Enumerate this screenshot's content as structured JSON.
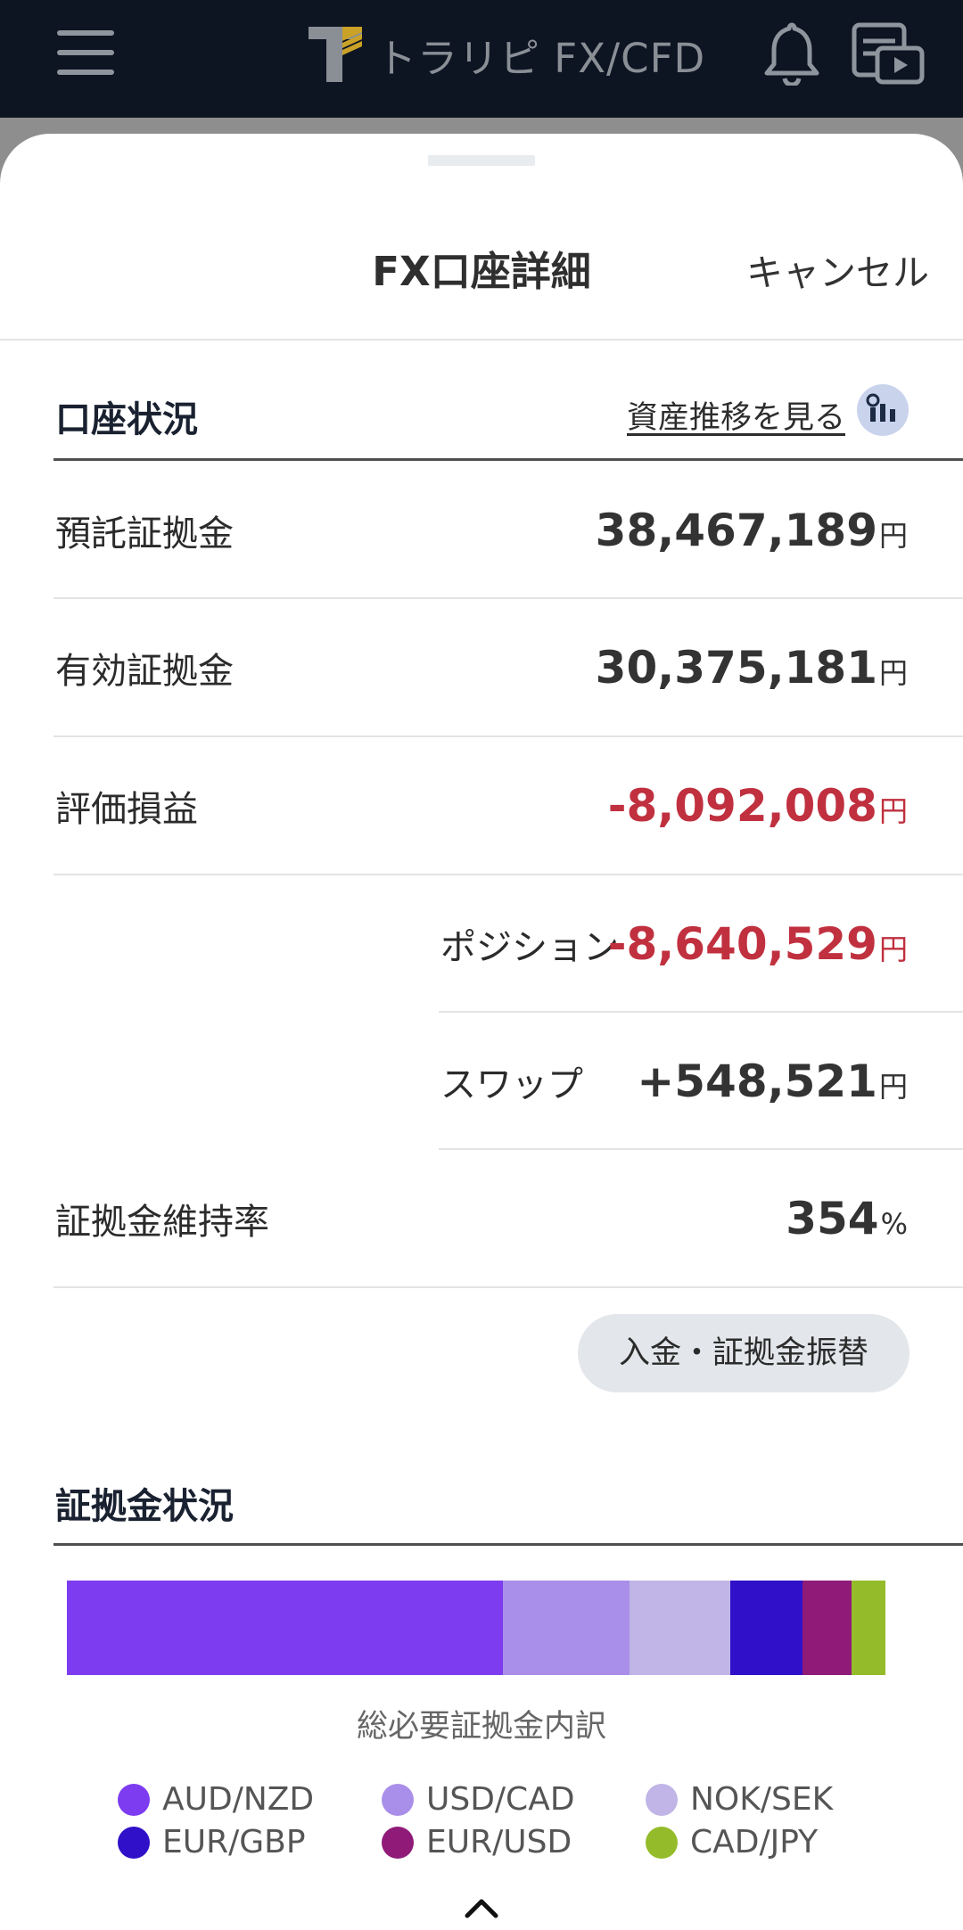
{
  "appbar": {
    "logo_text": "トラリピ FX/CFD"
  },
  "sheet": {
    "title": "FX口座詳細",
    "cancel_label": "キャンセル"
  },
  "account": {
    "section_title": "口座状況",
    "history_link": "資産推移を見る",
    "rows": [
      {
        "label": "預託証拠金",
        "value": "38,467,189",
        "unit": "円"
      },
      {
        "label": "有効証拠金",
        "value": "30,375,181",
        "unit": "円"
      },
      {
        "label": "評価損益",
        "value": "-8,092,008",
        "unit": "円"
      },
      {
        "label": "ポジション",
        "value": "-8,640,529",
        "unit": "円"
      },
      {
        "label": "スワップ",
        "value": "+548,521",
        "unit": "円"
      },
      {
        "label": "証拠金維持率",
        "value": "354",
        "unit": "%"
      }
    ],
    "deposit_button": "入金・証拠金振替"
  },
  "margin": {
    "section_title": "証拠金状況",
    "caption": "総必要証拠金内訳",
    "breakdown": [
      {
        "pair": "AUD/NZD",
        "share": 0.533,
        "color": "#7d3cf0"
      },
      {
        "pair": "USD/CAD",
        "share": 0.154,
        "color": "#a98fe9"
      },
      {
        "pair": "NOK/SEK",
        "share": 0.123,
        "color": "#c0b5e6"
      },
      {
        "pair": "EUR/GBP",
        "share": 0.089,
        "color": "#3010c9"
      },
      {
        "pair": "EUR/USD",
        "share": 0.06,
        "color": "#8f1a78"
      },
      {
        "pair": "CAD/JPY",
        "share": 0.041,
        "color": "#94bc2a"
      }
    ]
  },
  "colors": {
    "negative": "#c0303f",
    "appbar": "#0d1422"
  }
}
